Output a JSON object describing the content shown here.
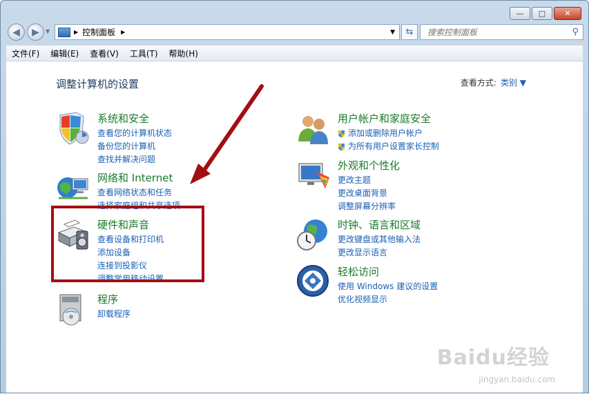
{
  "window": {
    "controls": [
      "—",
      "□",
      "✕"
    ]
  },
  "nav": {
    "path_root": "控制面板",
    "search_placeholder": "搜索控制面板"
  },
  "menu": [
    "文件(F)",
    "编辑(E)",
    "查看(V)",
    "工具(T)",
    "帮助(H)"
  ],
  "page": {
    "title": "调整计算机的设置",
    "viewby_label": "查看方式:",
    "viewby_value": "类别 ▼"
  },
  "categories_left": [
    {
      "title": "系统和安全",
      "links": [
        "查看您的计算机状态",
        "备份您的计算机",
        "查找并解决问题"
      ]
    },
    {
      "title": "网络和 Internet",
      "links": [
        "查看网络状态和任务",
        "选择家庭组和共享选项"
      ]
    },
    {
      "title": "硬件和声音",
      "links": [
        "查看设备和打印机",
        "添加设备",
        "连接到投影仪",
        "调整常用移动设置"
      ]
    },
    {
      "title": "程序",
      "links": [
        "卸载程序"
      ]
    }
  ],
  "categories_right": [
    {
      "title": "用户帐户和家庭安全",
      "links": [
        "添加或删除用户帐户",
        "为所有用户设置家长控制"
      ]
    },
    {
      "title": "外观和个性化",
      "links": [
        "更改主题",
        "更改桌面背景",
        "调整屏幕分辨率"
      ]
    },
    {
      "title": "时钟、语言和区域",
      "links": [
        "更改键盘或其他输入法",
        "更改显示语言"
      ]
    },
    {
      "title": "轻松访问",
      "links": [
        "使用 Windows 建议的设置",
        "优化视频显示"
      ]
    }
  ],
  "watermark": {
    "text": "Baidu经验",
    "sub": "jingyan.baidu.com"
  },
  "colors": {
    "heading_green": "#1a7a2c",
    "link_blue": "#1a5fb4",
    "highlight_red": "#a30e13"
  }
}
